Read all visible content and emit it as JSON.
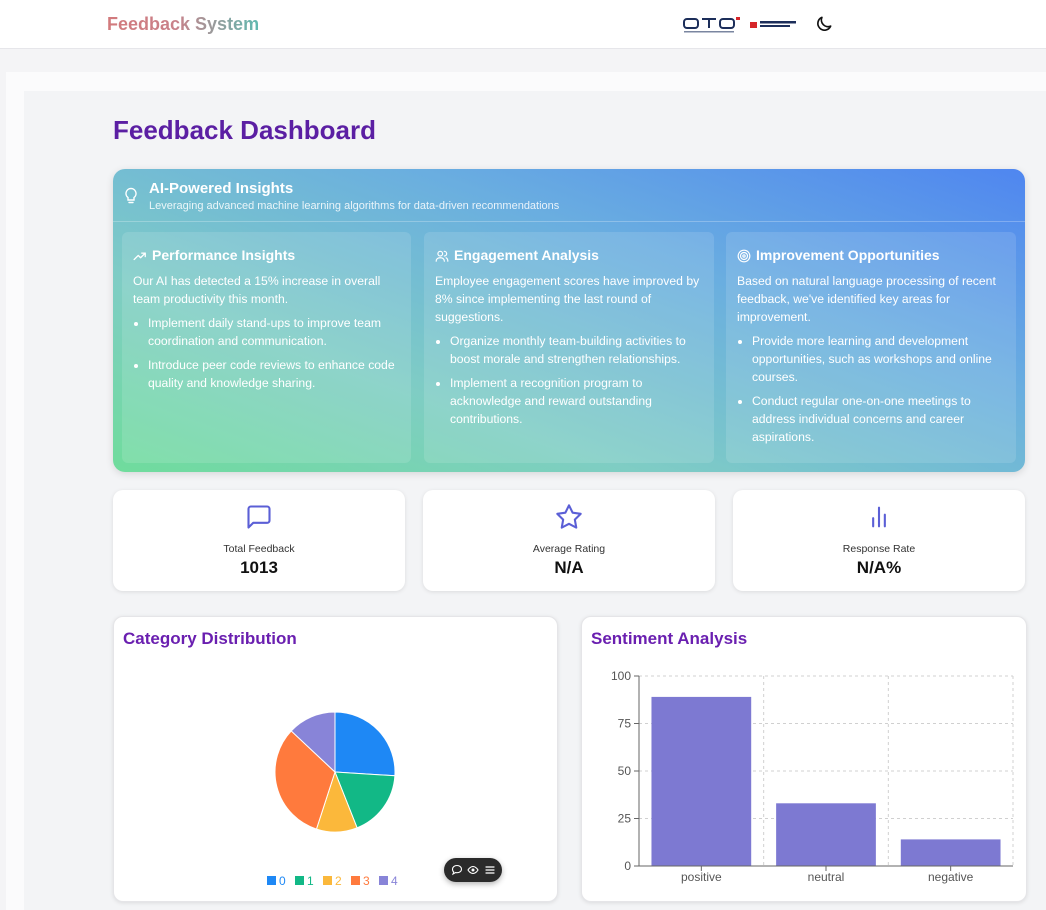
{
  "header": {
    "brand": "Feedback System",
    "theme_toggle_icon": "moon-icon"
  },
  "dashboard": {
    "title": "Feedback Dashboard"
  },
  "ai_insights": {
    "title": "AI-Powered Insights",
    "subtitle": "Leveraging advanced machine learning algorithms for data-driven recommendations",
    "columns": [
      {
        "icon": "trending-up-icon",
        "title": "Performance Insights",
        "body": "Our AI has detected a 15% increase in overall team productivity this month.",
        "bullets": [
          "Implement daily stand-ups to improve team coordination and communication.",
          "Introduce peer code reviews to enhance code quality and knowledge sharing."
        ]
      },
      {
        "icon": "users-icon",
        "title": "Engagement Analysis",
        "body": "Employee engagement scores have improved by 8% since implementing the last round of suggestions.",
        "bullets": [
          "Organize monthly team-building activities to boost morale and strengthen relationships.",
          "Implement a recognition program to acknowledge and reward outstanding contributions."
        ]
      },
      {
        "icon": "target-icon",
        "title": "Improvement Opportunities",
        "body": "Based on natural language processing of recent feedback, we've identified key areas for improvement.",
        "bullets": [
          "Provide more learning and development opportunities, such as workshops and online courses.",
          "Conduct regular one-on-one meetings to address individual concerns and career aspirations."
        ]
      }
    ]
  },
  "stats": [
    {
      "icon": "message-square-icon",
      "label": "Total Feedback",
      "value": "1013"
    },
    {
      "icon": "star-icon",
      "label": "Average Rating",
      "value": "N/A"
    },
    {
      "icon": "bar-chart-icon",
      "label": "Response Rate",
      "value": "N/A%"
    }
  ],
  "category_chart": {
    "title": "Category Distribution"
  },
  "sentiment_chart": {
    "title": "Sentiment Analysis"
  },
  "colors": {
    "brand_purple": "#5b1fa3",
    "bar": "#7d79d2",
    "pie": [
      "#1e88f5",
      "#12b886",
      "#fbb83b",
      "#ff7a3d",
      "#8884d8"
    ]
  },
  "chart_data": [
    {
      "type": "pie",
      "title": "Category Distribution",
      "categories": [
        "0",
        "1",
        "2",
        "3",
        "4"
      ],
      "values": [
        26,
        18,
        11,
        32,
        13
      ],
      "legend": "bottom"
    },
    {
      "type": "bar",
      "title": "Sentiment Analysis",
      "categories": [
        "positive",
        "neutral",
        "negative"
      ],
      "values": [
        89,
        33,
        14
      ],
      "ylim": [
        0,
        100
      ],
      "yticks": [
        0,
        25,
        50,
        75,
        100
      ],
      "grid": true
    }
  ]
}
